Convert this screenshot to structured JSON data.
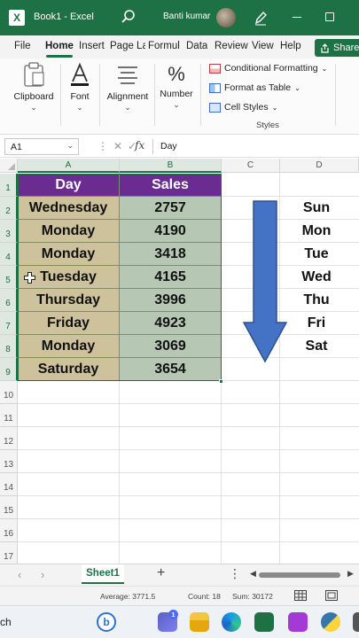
{
  "titlebar": {
    "app_glyph": "X",
    "title": "Book1 - Excel",
    "user": "Banti kumar"
  },
  "tabs": [
    "File",
    "Home",
    "Insert",
    "Page La",
    "Formul",
    "Data",
    "Review",
    "View",
    "Help"
  ],
  "share_label": "Share",
  "ribbon": {
    "clipboard": "Clipboard",
    "font": "Font",
    "alignment": "Alignment",
    "number": "Number",
    "conditional_formatting": "Conditional Formatting",
    "format_as_table": "Format as Table",
    "cell_styles": "Cell Styles",
    "styles_group": "Styles",
    "number_glyph": "%"
  },
  "formula_bar": {
    "name_box": "A1",
    "fx": "fx",
    "value": "Day"
  },
  "columns": [
    "A",
    "B",
    "C",
    "D"
  ],
  "rows": [
    "1",
    "2",
    "3",
    "4",
    "5",
    "6",
    "7",
    "8",
    "9",
    "10",
    "11",
    "12",
    "13",
    "14",
    "15",
    "16",
    "17"
  ],
  "table": {
    "headers": [
      "Day",
      "Sales"
    ],
    "rows": [
      [
        "Wednesday",
        "2757"
      ],
      [
        "Monday",
        "4190"
      ],
      [
        "Monday",
        "3418"
      ],
      [
        "Tuesday",
        "4165"
      ],
      [
        "Thursday",
        "3996"
      ],
      [
        "Friday",
        "4923"
      ],
      [
        "Monday",
        "3069"
      ],
      [
        "Saturday",
        "3654"
      ]
    ]
  },
  "weekdays": [
    "Sun",
    "Mon",
    "Tue",
    "Wed",
    "Thu",
    "Fri",
    "Sat"
  ],
  "sheet_tab": "Sheet1",
  "status": {
    "average": "Average: 3771.5",
    "count": "Count: 18",
    "sum": "Sum: 30172"
  },
  "taskbar": {
    "search": "ch",
    "teams_badge": "1"
  },
  "colors": {
    "excel_green": "#1e7145",
    "header_purple": "#6a2c91",
    "day_fill": "#cec29c",
    "sales_fill": "#b6c8b4",
    "arrow_blue": "#4472c4"
  }
}
